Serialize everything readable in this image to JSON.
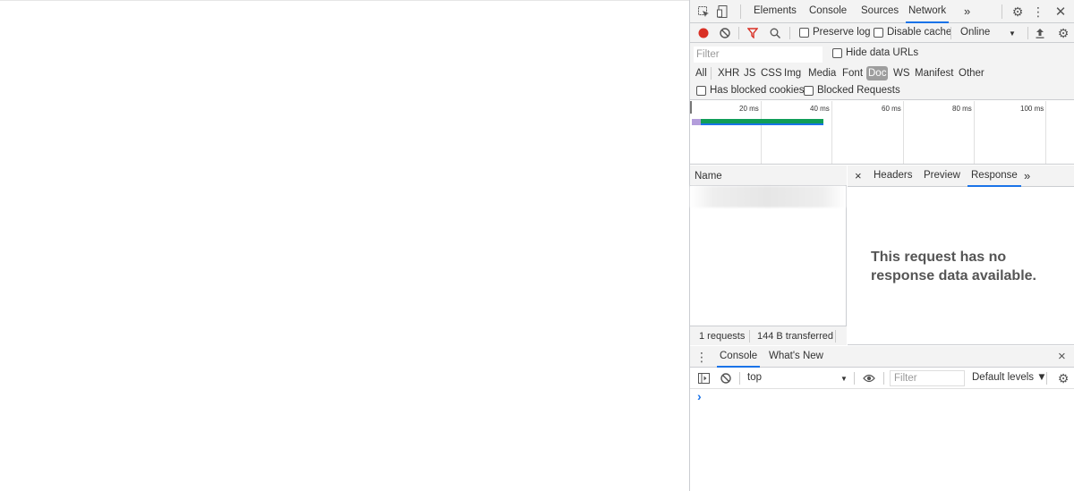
{
  "devtools": {
    "tabs": [
      {
        "label": "Elements",
        "active": false
      },
      {
        "label": "Console",
        "active": false
      },
      {
        "label": "Sources",
        "active": false
      },
      {
        "label": "Network",
        "active": true
      }
    ],
    "more_tabs": "»",
    "network_toolbar": {
      "preserve_log": "Preserve log",
      "disable_cache": "Disable cache",
      "throttling": "Online"
    },
    "filter": {
      "placeholder": "Filter",
      "hide_data_urls": "Hide data URLs",
      "types": [
        "All",
        "XHR",
        "JS",
        "CSS",
        "Img",
        "Media",
        "Font",
        "Doc",
        "WS",
        "Manifest",
        "Other"
      ],
      "active_type": "Doc",
      "has_blocked_cookies": "Has blocked cookies",
      "blocked_requests": "Blocked Requests"
    },
    "timeline": {
      "labels": [
        "20 ms",
        "40 ms",
        "60 ms",
        "80 ms",
        "100 ms"
      ]
    },
    "requests": {
      "column_name": "Name",
      "status_requests": "1 requests",
      "status_transferred": "144 B transferred"
    },
    "detail": {
      "close": "×",
      "tabs": [
        {
          "label": "Headers",
          "active": false
        },
        {
          "label": "Preview",
          "active": false
        },
        {
          "label": "Response",
          "active": true
        }
      ],
      "more": "»",
      "message": "This request has no response data available."
    },
    "drawer": {
      "tabs": [
        {
          "label": "Console",
          "active": true
        },
        {
          "label": "What's New",
          "active": false
        }
      ],
      "close": "×",
      "context": "top",
      "filter_placeholder": "Filter",
      "levels": "Default levels ▼",
      "prompt": "›"
    },
    "colors": {
      "accent": "#1a73e8",
      "record": "#d93025",
      "filter_active": "#d93025",
      "timeline_green": "#0f9d58",
      "timeline_blue": "#1a73e8"
    }
  }
}
